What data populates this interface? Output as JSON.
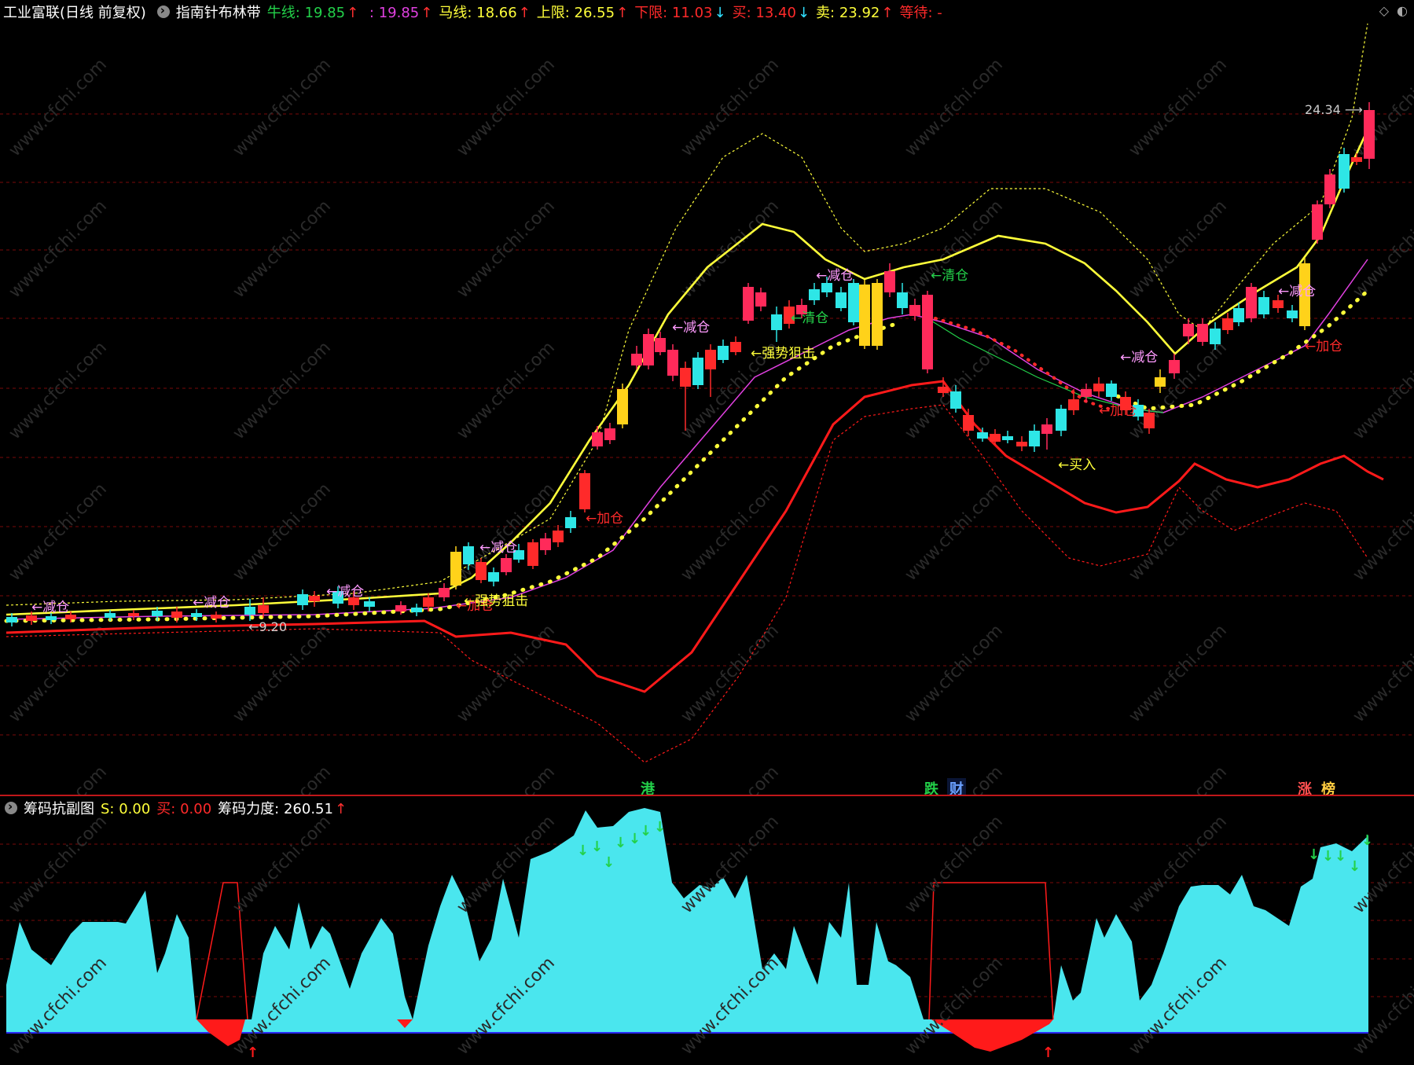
{
  "main_header": {
    "stock": "工业富联(日线 前复权)",
    "indicator": "指南针布林带",
    "items": [
      {
        "label": "牛线: ",
        "value": "19.85",
        "arrow": "↑",
        "color": "#23d14a",
        "arrow_color": "#ff3030"
      },
      {
        "label": " : ",
        "value": "19.85",
        "arrow": "↑",
        "color": "#e040e0",
        "arrow_color": "#ff3030"
      },
      {
        "label": "马线: ",
        "value": "18.66",
        "arrow": "↑",
        "color": "#ffff3a",
        "arrow_color": "#ff3030"
      },
      {
        "label": "上限: ",
        "value": "26.55",
        "arrow": "↑",
        "color": "#ffff3a",
        "arrow_color": "#ff3030"
      },
      {
        "label": "下限: ",
        "value": "11.03",
        "arrow": "↓",
        "color": "#ff2a2a",
        "arrow_color": "#30e0ff"
      },
      {
        "label": "买: ",
        "value": "13.40",
        "arrow": "↓",
        "color": "#ff2a2a",
        "arrow_color": "#30e0ff"
      },
      {
        "label": "卖: ",
        "value": "23.92",
        "arrow": "↑",
        "color": "#ffff3a",
        "arrow_color": "#ff3030"
      },
      {
        "label": "等待: ",
        "value": "-",
        "arrow": "",
        "color": "#ff2a2a",
        "arrow_color": "#ff3030"
      }
    ]
  },
  "sub_header": {
    "indicator": "筹码抗副图",
    "items": [
      {
        "label": "S: ",
        "value": "0.00",
        "arrow": "",
        "color": "#ffff3a"
      },
      {
        "label": "买: ",
        "value": "0.00",
        "arrow": "",
        "color": "#ff2a2a"
      },
      {
        "label": "筹码力度: ",
        "value": "260.51",
        "arrow": "↑",
        "color": "#ffffff"
      }
    ]
  },
  "price_labels": {
    "high": "24.34",
    "low": "9.20"
  },
  "signals": [
    {
      "text": "←减仓",
      "color": "#ff9bff"
    },
    {
      "text": "←加仓",
      "color": "#ff2a2a"
    },
    {
      "text": "←强势狙击",
      "color": "#ffff3a"
    },
    {
      "text": "←清仓",
      "color": "#23d14a"
    },
    {
      "text": "←买入",
      "color": "#ffff3a"
    }
  ],
  "event_tags": [
    {
      "text": "港",
      "color": "#23d14a",
      "bg": "#0a2a0a"
    },
    {
      "text": "跌",
      "color": "#23d14a",
      "bg": "#0a2a0a"
    },
    {
      "text": "财",
      "color": "#6aa0ff",
      "bg": "#0a1030"
    },
    {
      "text": "涨",
      "color": "#ff5050",
      "bg": "#2a0a0a"
    },
    {
      "text": "榜",
      "color": "#ffcc40",
      "bg": "#2a1a0a"
    }
  ],
  "watermark": "www.cfchi.com",
  "colors": {
    "grid": "#7a0a0a",
    "bull_line": "#ffff3a",
    "mid_line": "#e040e0",
    "lower": "#ff1a1a",
    "dots": "#ffff3a",
    "up_candle": "#ff2a5a",
    "down_candle": "#2ee6e6",
    "area": "#4ae6ee",
    "base": "#2a2aff"
  }
}
